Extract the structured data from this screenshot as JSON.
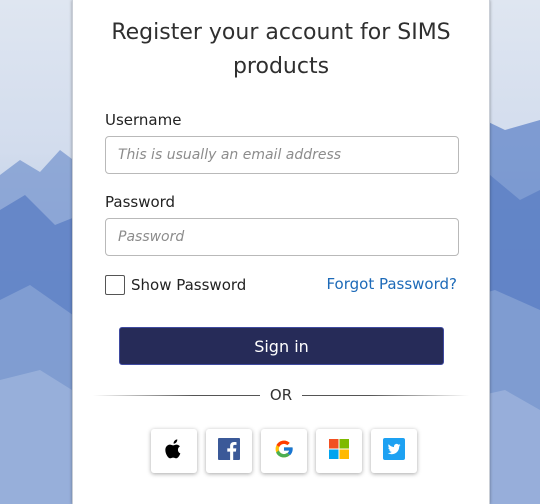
{
  "title": "Register your account for SIMS products",
  "username": {
    "label": "Username",
    "placeholder": "This is usually an email address",
    "value": ""
  },
  "password": {
    "label": "Password",
    "placeholder": "Password",
    "value": ""
  },
  "show_password": {
    "label": "Show Password",
    "checked": false
  },
  "forgot_password": "Forgot Password?",
  "sign_in": "Sign in",
  "divider": "OR",
  "providers": [
    {
      "name": "Apple",
      "icon": "apple-icon"
    },
    {
      "name": "Facebook",
      "icon": "facebook-icon"
    },
    {
      "name": "Google",
      "icon": "google-icon"
    },
    {
      "name": "Microsoft",
      "icon": "microsoft-icon"
    },
    {
      "name": "Twitter",
      "icon": "twitter-icon"
    }
  ],
  "colors": {
    "sign_in_bg": "#262b58",
    "link": "#1d6ab8",
    "facebook": "#3b5998",
    "twitter": "#1da1f2"
  }
}
